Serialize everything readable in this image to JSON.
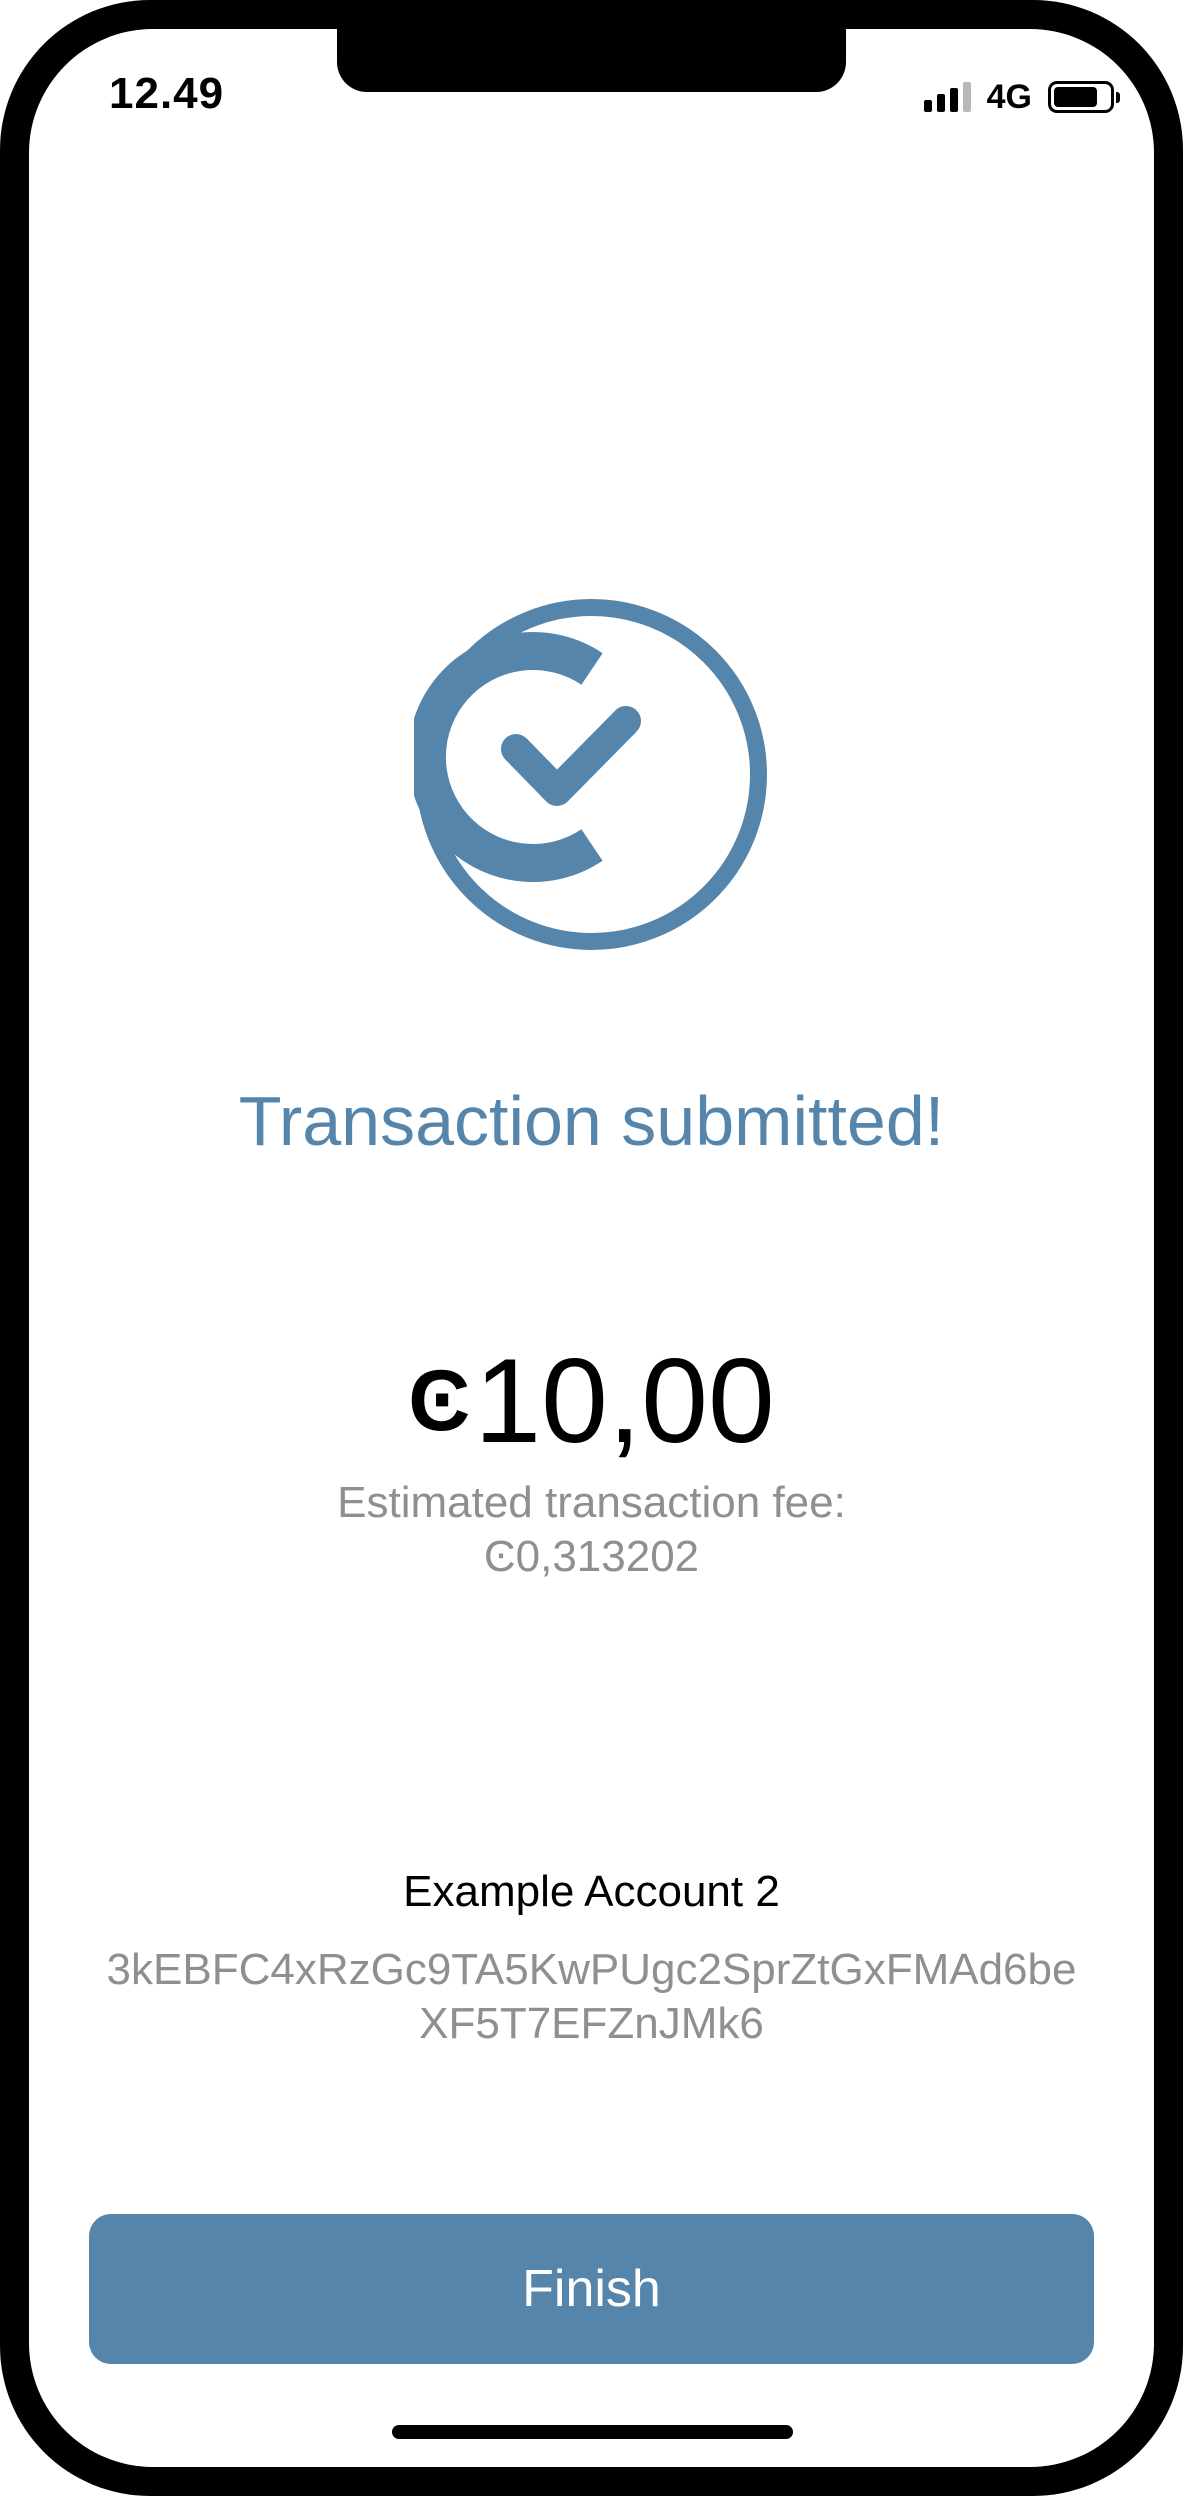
{
  "status_bar": {
    "time": "12.49",
    "network": "4G",
    "signal_bars_active": 3,
    "signal_bars_total": 4,
    "battery_level": 0.8
  },
  "confirmation": {
    "icon": "check-circle-icon",
    "title": "Transaction submitted!",
    "amount_symbol": "Ͼ",
    "amount_value": "10,00",
    "fee_label": "Estimated transaction fee:",
    "fee_value": "Ͼ0,313202"
  },
  "recipient": {
    "name": "Example Account 2",
    "address_line1": "3kEBFC4xRzGc9TA5KwPUgc2SprZtGxFMAd6be",
    "address_line2": "XF5T7EFZnJMk6"
  },
  "actions": {
    "finish_label": "Finish"
  },
  "colors": {
    "accent": "#5585ab",
    "muted_text": "#8f8f8f",
    "text": "#000000",
    "background": "#ffffff"
  }
}
